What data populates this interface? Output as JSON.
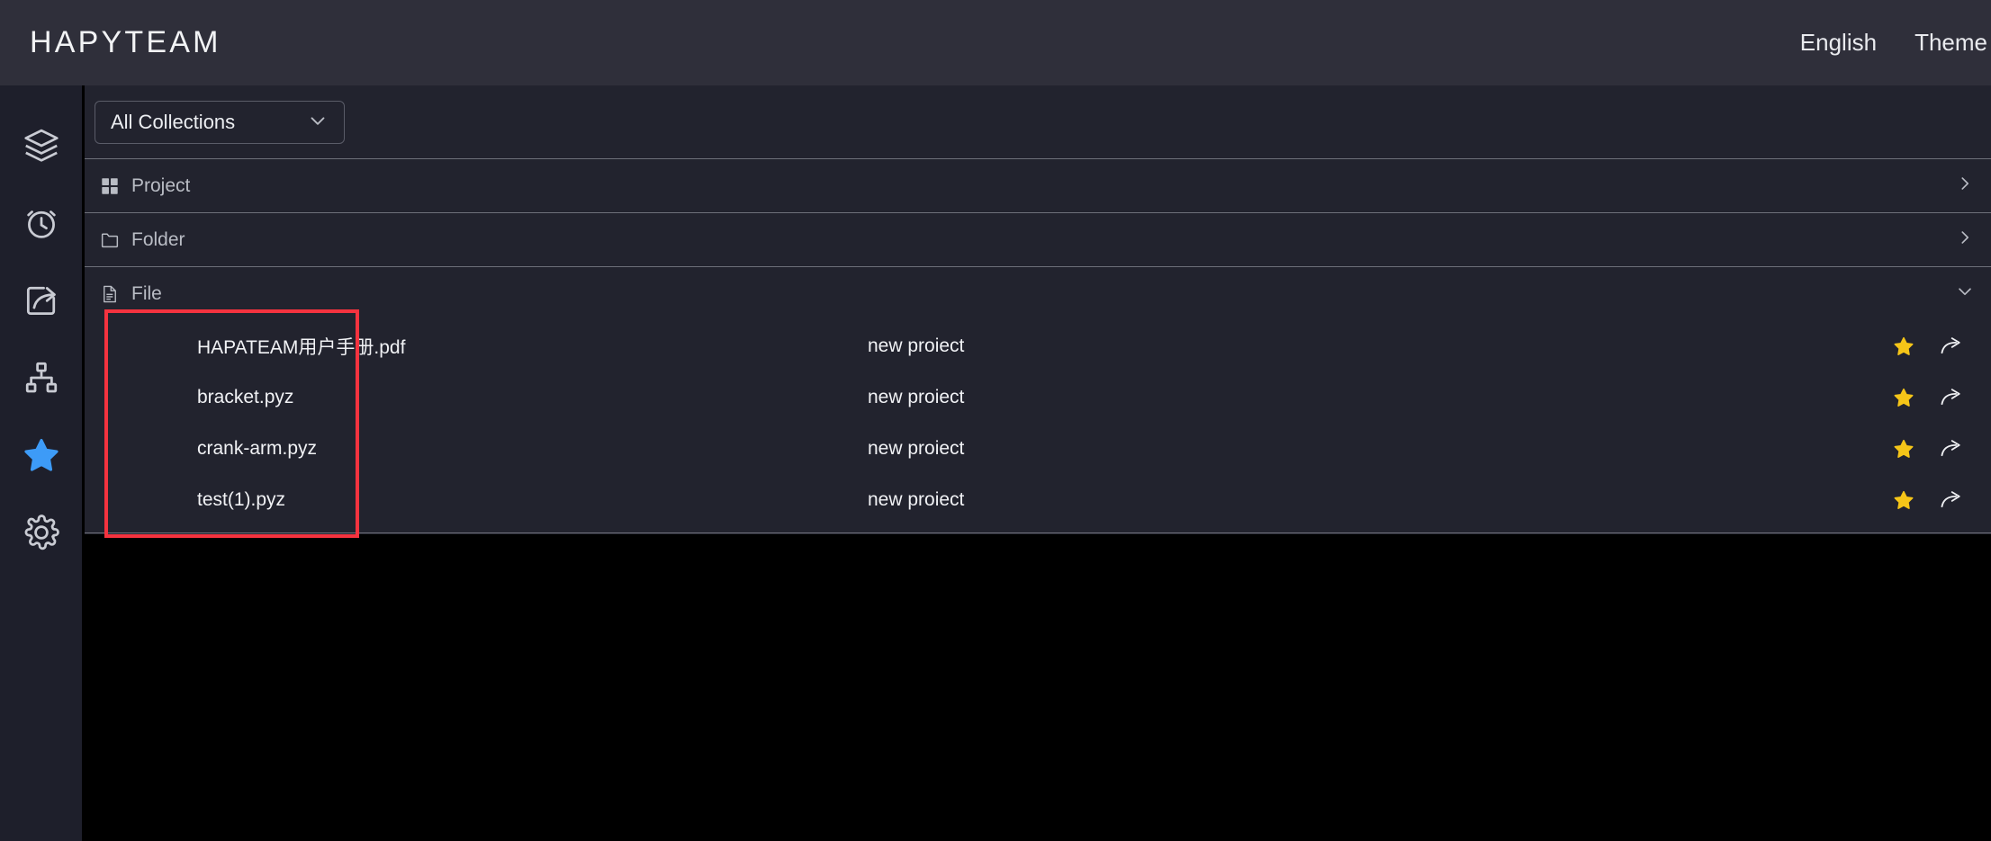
{
  "header": {
    "brand": "HAPYTEAM",
    "links": [
      {
        "label": "English",
        "name": "language-selector"
      },
      {
        "label": "Theme",
        "name": "theme-selector"
      }
    ]
  },
  "sidebar": {
    "items": [
      {
        "icon": "layers-icon",
        "name": "sidebar-item-layers",
        "active": false
      },
      {
        "icon": "clock-icon",
        "name": "sidebar-item-recent",
        "active": false
      },
      {
        "icon": "share-export-icon",
        "name": "sidebar-item-share",
        "active": false
      },
      {
        "icon": "sitemap-icon",
        "name": "sidebar-item-sitemap",
        "active": false
      },
      {
        "icon": "star-icon",
        "name": "sidebar-item-favorites",
        "active": true
      },
      {
        "icon": "gear-icon",
        "name": "sidebar-item-settings",
        "active": false
      }
    ],
    "active_color": "#3d9bf7",
    "inactive_color": "#c9cbd3"
  },
  "toolbar": {
    "collection_select": {
      "value": "All Collections",
      "icon": "chevron-down-icon"
    }
  },
  "sections": [
    {
      "label": "Project",
      "icon": "grid-icon",
      "expanded": false,
      "chevron": "chevron-right-icon"
    },
    {
      "label": "Folder",
      "icon": "folder-icon",
      "expanded": false,
      "chevron": "chevron-right-icon"
    },
    {
      "label": "File",
      "icon": "document-icon",
      "expanded": true,
      "chevron": "chevron-down-icon"
    }
  ],
  "files": [
    {
      "name": "HAPATEAM用户手册.pdf",
      "project": "new proiect",
      "favorite": true,
      "favorite_icon": "star-icon",
      "share_icon": "share-arrow-icon"
    },
    {
      "name": "bracket.pyz",
      "project": "new proiect",
      "favorite": true,
      "favorite_icon": "star-icon",
      "share_icon": "share-arrow-icon"
    },
    {
      "name": "crank-arm.pyz",
      "project": "new proiect",
      "favorite": true,
      "favorite_icon": "star-icon",
      "share_icon": "share-arrow-icon"
    },
    {
      "name": "test(1).pyz",
      "project": "new proiect",
      "favorite": true,
      "favorite_icon": "star-icon",
      "share_icon": "share-arrow-icon"
    }
  ],
  "annotation": {
    "highlight_color": "#f5333f",
    "target": "file-name-column"
  },
  "colors": {
    "header_bg": "#2f2f3a",
    "sidebar_bg": "#1e1f2b",
    "panel_bg": "#22232e",
    "page_bg": "#000000",
    "divider": "#6e707a",
    "star_gold": "#f5c518",
    "accent_blue": "#3d9bf7"
  }
}
